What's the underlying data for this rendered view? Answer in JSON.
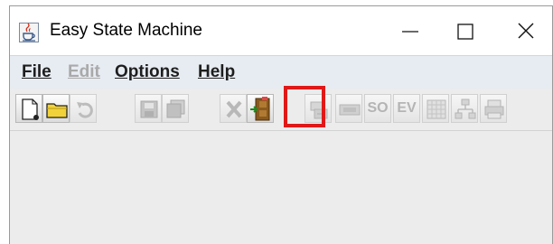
{
  "window": {
    "title": "Easy State Machine",
    "app_icon": "java-cup-icon",
    "controls": [
      "minimize-icon",
      "maximize-icon",
      "close-icon"
    ]
  },
  "menu": {
    "file": "File",
    "edit": "Edit",
    "options": "Options",
    "help": "Help"
  },
  "toolbar": {
    "buttons": [
      {
        "icon": "new-document-icon",
        "enabled": true
      },
      {
        "icon": "open-folder-icon",
        "enabled": true
      },
      {
        "icon": "undo-icon",
        "enabled": false
      },
      {
        "icon": "save-icon",
        "enabled": false
      },
      {
        "icon": "save-all-icon",
        "enabled": false
      },
      {
        "icon": "delete-icon",
        "enabled": false
      },
      {
        "icon": "exit-door-icon",
        "enabled": true
      },
      {
        "icon": "add-state-icon",
        "enabled": false,
        "highlighted": true
      },
      {
        "icon": "state-icon",
        "enabled": false
      },
      {
        "icon": "so-icon",
        "label": "SO",
        "enabled": false
      },
      {
        "icon": "ev-icon",
        "label": "EV",
        "enabled": false
      },
      {
        "icon": "table-icon",
        "enabled": false
      },
      {
        "icon": "transition-icon",
        "enabled": false
      },
      {
        "icon": "print-icon",
        "enabled": false
      }
    ],
    "so_label": "SO",
    "ev_label": "EV"
  },
  "colors": {
    "highlight": "#e01818",
    "menubar": "#e7ecf2",
    "disabled_text": "#a9a9a9"
  }
}
